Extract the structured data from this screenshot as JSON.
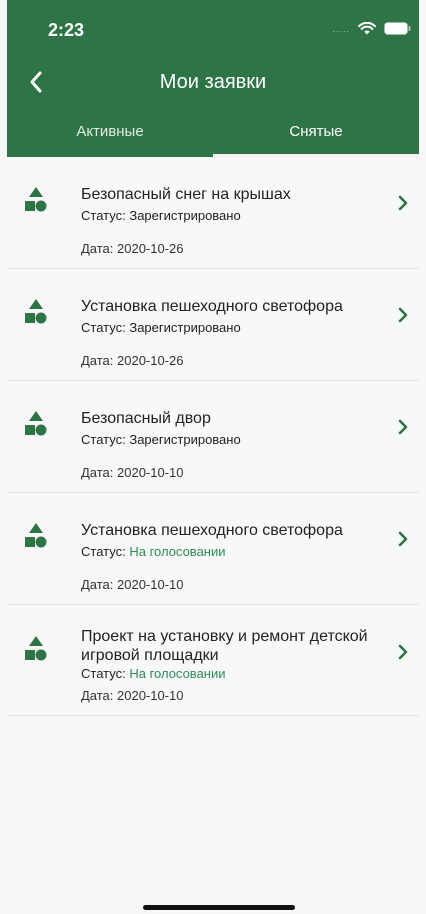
{
  "status_bar": {
    "time": "2:23",
    "signal": "....."
  },
  "header": {
    "title": "Мои заявки"
  },
  "tabs": [
    {
      "label": "Активные",
      "active": false
    },
    {
      "label": "Снятые",
      "active": true
    }
  ],
  "items": [
    {
      "title": "Безопасный снег на крышах",
      "status_label": "Статус:",
      "status_value": "Зарегистрировано",
      "date": "Дата: 2020-10-26"
    },
    {
      "title": "Установка пешеходного светофора",
      "status_label": "Статус:",
      "status_value": "Зарегистрировано",
      "date": "Дата: 2020-10-26"
    },
    {
      "title": "Безопасный двор",
      "status_label": "Статус:",
      "status_value": "Зарегистрировано",
      "date": "Дата: 2020-10-10"
    },
    {
      "title": "Установка пешеходного светофора",
      "status_label": "Статус:",
      "status_value": "На голосовании",
      "date": "Дата: 2020-10-10"
    },
    {
      "title": "Проект на установку и ремонт детской игровой площадки",
      "status_label": "Статус:",
      "status_value": "На голосовании",
      "date": "Дата: 2020-10-10"
    }
  ],
  "colors": {
    "brand": "#2f7446",
    "status_voting": "#2e8b57",
    "icon": "#2f7446"
  },
  "icons": {
    "item": "shapes-icon",
    "chevron": "chevron-right-icon",
    "back": "back-arrow-icon"
  }
}
